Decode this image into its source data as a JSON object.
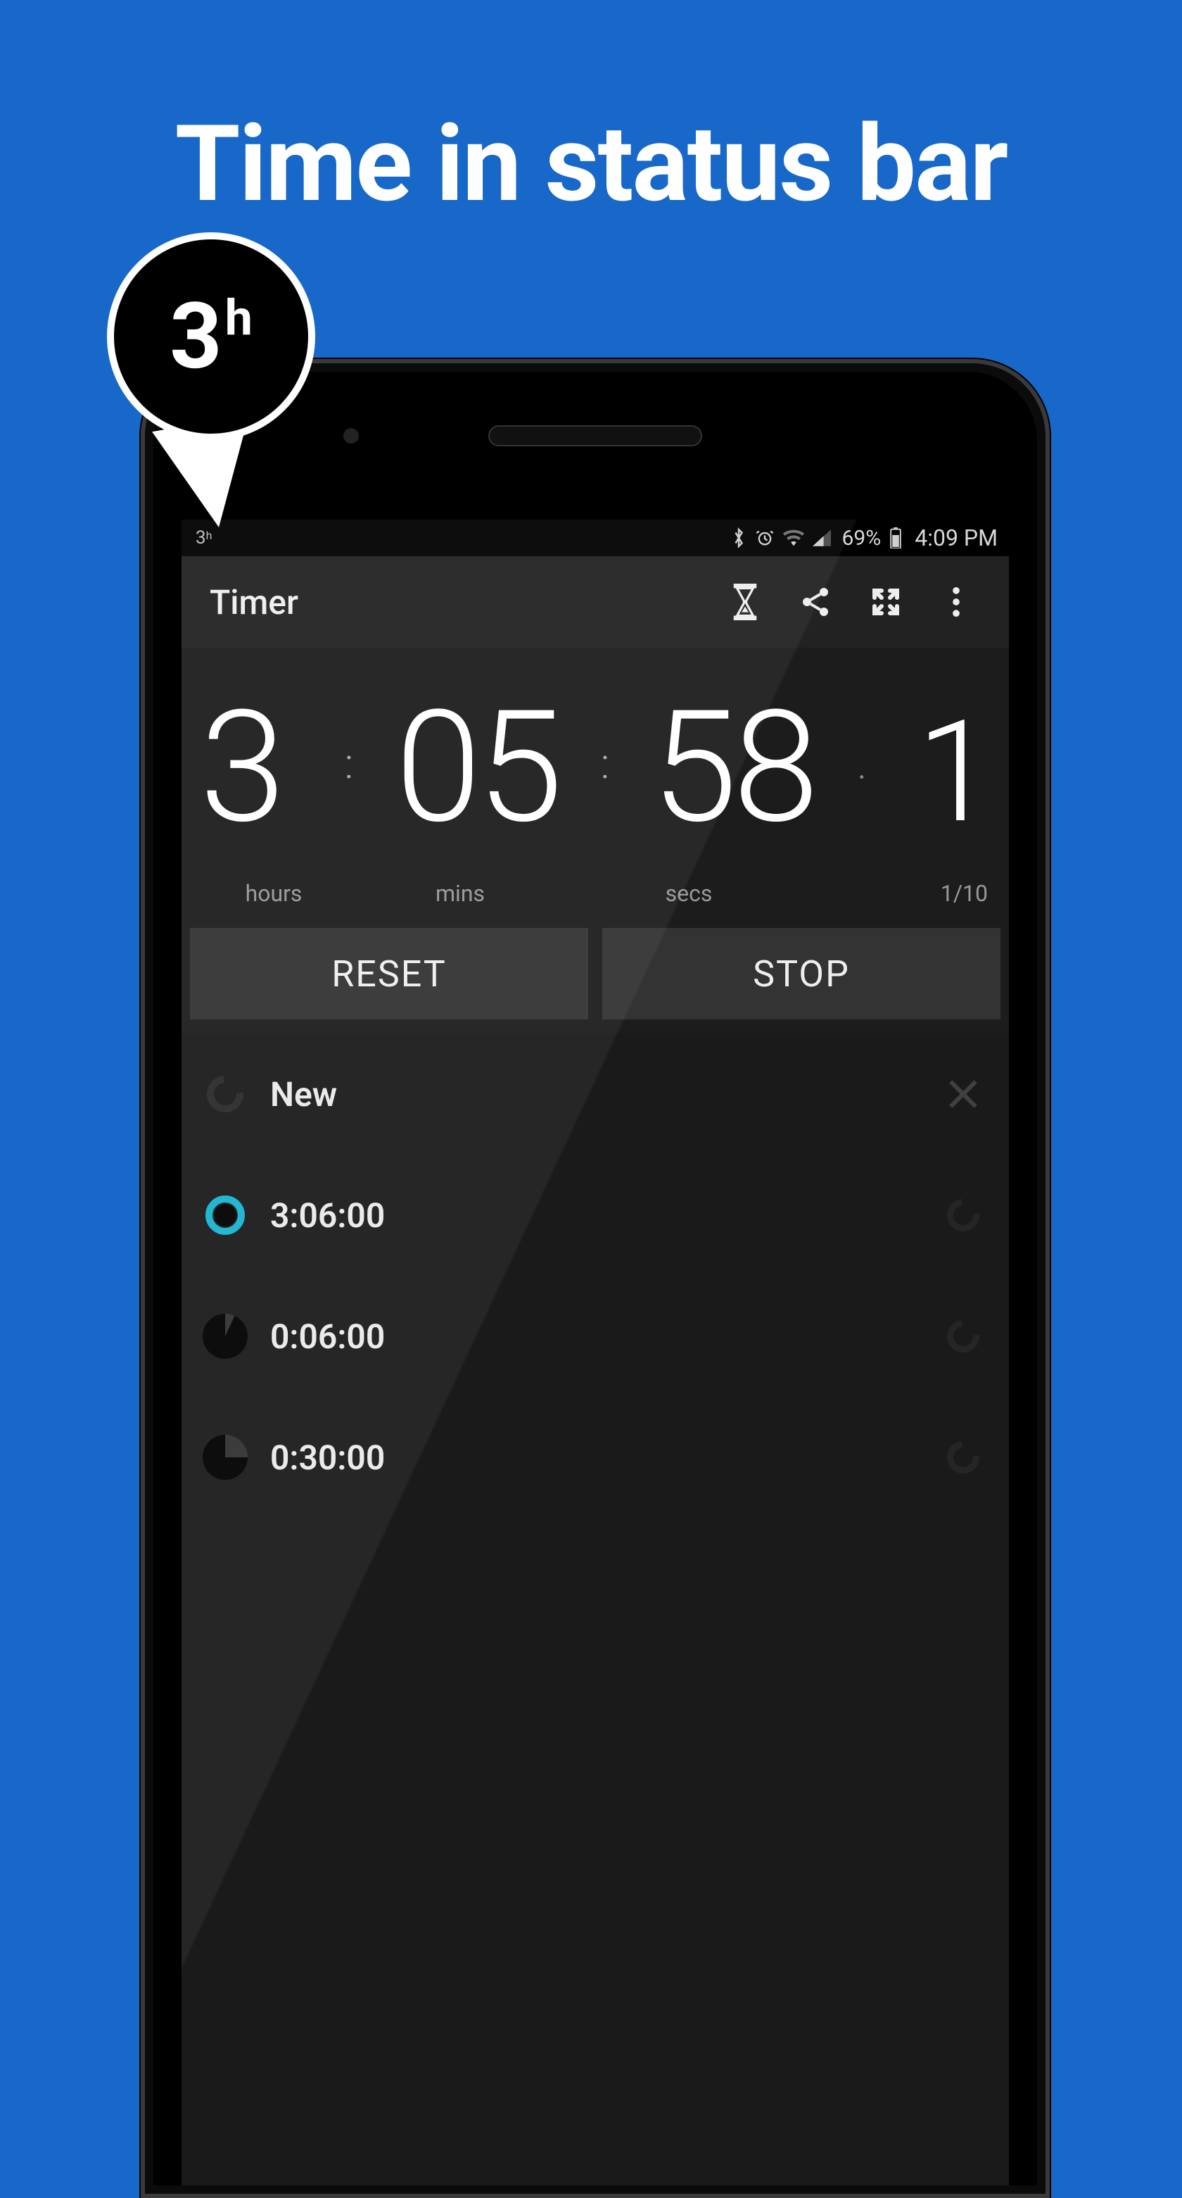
{
  "promo": {
    "headline": "Time in status bar",
    "callout_number": "3",
    "callout_unit": "h"
  },
  "status_bar": {
    "app_badge_number": "3",
    "app_badge_unit": "h",
    "battery_text": "69%",
    "clock": "4:09 PM"
  },
  "toolbar": {
    "title": "Timer"
  },
  "timer": {
    "hours": "3",
    "mins": "05",
    "secs": "58",
    "tenths": "1",
    "label_hours": "hours",
    "label_mins": "mins",
    "label_secs": "secs",
    "label_tenths": "1/10"
  },
  "actions": {
    "reset": "RESET",
    "stop": "STOP"
  },
  "list": {
    "items": [
      {
        "label": "New",
        "icon": "dim",
        "action": "x"
      },
      {
        "label": "3:06:00",
        "icon": "ring",
        "action": "reload"
      },
      {
        "label": "0:06:00",
        "icon": "pie-small",
        "action": "reload"
      },
      {
        "label": "0:30:00",
        "icon": "pie-big",
        "action": "reload"
      }
    ]
  }
}
